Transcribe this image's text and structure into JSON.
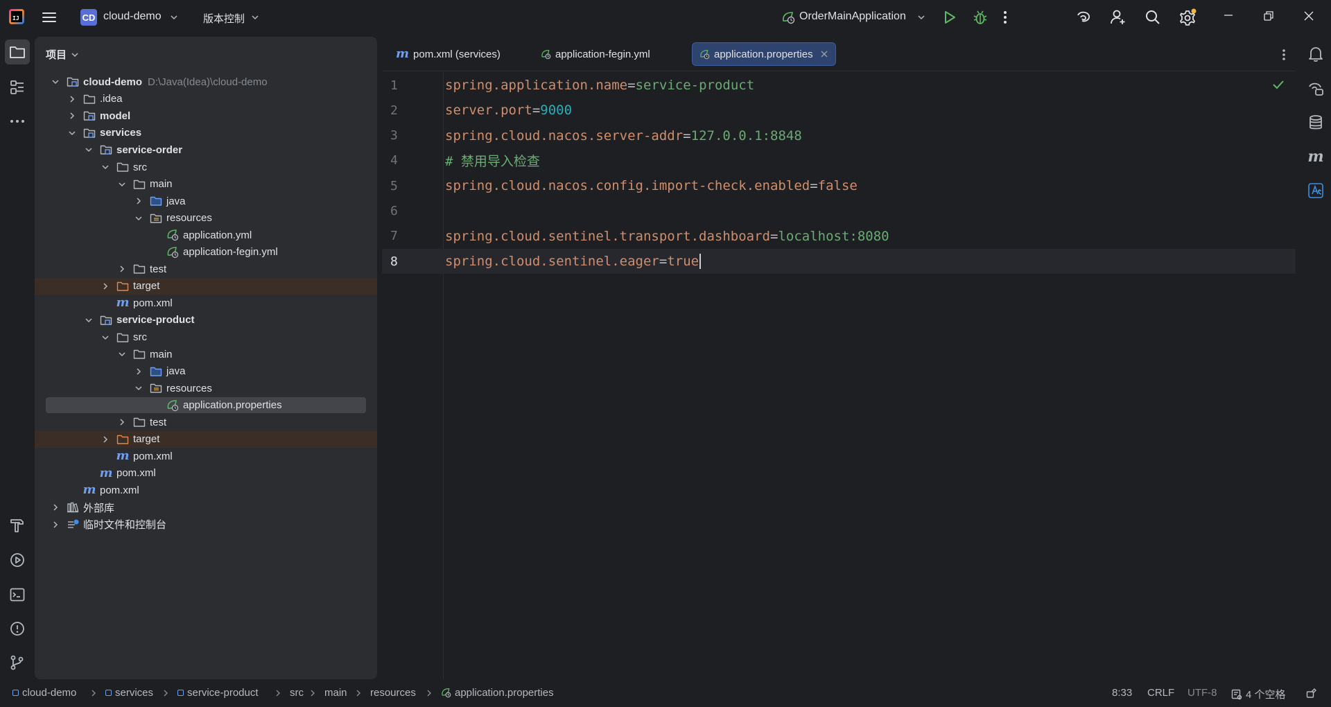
{
  "titlebar": {
    "project_badge": "CD",
    "project_name": "cloud-demo",
    "vcs_menu": "版本控制",
    "run_config": "OrderMainApplication"
  },
  "project_panel": {
    "title": "项目",
    "tree": [
      {
        "label": "cloud-demo",
        "path": "D:\\Java(Idea)\\cloud-demo",
        "bold": true,
        "depth": 0,
        "expander": "open",
        "icon": "module"
      },
      {
        "label": ".idea",
        "depth": 1,
        "expander": "closed",
        "icon": "folder"
      },
      {
        "label": "model",
        "bold": true,
        "depth": 1,
        "expander": "closed",
        "icon": "module"
      },
      {
        "label": "services",
        "bold": true,
        "depth": 1,
        "expander": "open",
        "icon": "module"
      },
      {
        "label": "service-order",
        "bold": true,
        "depth": 2,
        "expander": "open",
        "icon": "module"
      },
      {
        "label": "src",
        "depth": 3,
        "expander": "open",
        "icon": "folder"
      },
      {
        "label": "main",
        "depth": 4,
        "expander": "open",
        "icon": "folder"
      },
      {
        "label": "java",
        "depth": 5,
        "expander": "closed",
        "icon": "folder-src"
      },
      {
        "label": "resources",
        "depth": 5,
        "expander": "open",
        "icon": "folder-res"
      },
      {
        "label": "application.yml",
        "depth": 6,
        "expander": "none",
        "icon": "spring"
      },
      {
        "label": "application-fegin.yml",
        "depth": 6,
        "expander": "none",
        "icon": "spring"
      },
      {
        "label": "test",
        "depth": 4,
        "expander": "closed",
        "icon": "folder"
      },
      {
        "label": "target",
        "depth": 3,
        "expander": "closed",
        "icon": "folder-excluded",
        "excluded": true
      },
      {
        "label": "pom.xml",
        "depth": 3,
        "expander": "none",
        "icon": "maven"
      },
      {
        "label": "service-product",
        "bold": true,
        "depth": 2,
        "expander": "open",
        "icon": "module"
      },
      {
        "label": "src",
        "depth": 3,
        "expander": "open",
        "icon": "folder"
      },
      {
        "label": "main",
        "depth": 4,
        "expander": "open",
        "icon": "folder"
      },
      {
        "label": "java",
        "depth": 5,
        "expander": "closed",
        "icon": "folder-src"
      },
      {
        "label": "resources",
        "depth": 5,
        "expander": "open",
        "icon": "folder-res"
      },
      {
        "label": "application.properties",
        "depth": 6,
        "expander": "none",
        "icon": "spring",
        "selected": true
      },
      {
        "label": "test",
        "depth": 4,
        "expander": "closed",
        "icon": "folder"
      },
      {
        "label": "target",
        "depth": 3,
        "expander": "closed",
        "icon": "folder-excluded",
        "excluded": true
      },
      {
        "label": "pom.xml",
        "depth": 3,
        "expander": "none",
        "icon": "maven"
      },
      {
        "label": "pom.xml",
        "depth": 2,
        "expander": "none",
        "icon": "maven"
      },
      {
        "label": "pom.xml",
        "depth": 1,
        "expander": "none",
        "icon": "maven"
      },
      {
        "label": "外部库",
        "depth": 0,
        "expander": "closed",
        "icon": "library"
      },
      {
        "label": "临时文件和控制台",
        "depth": 0,
        "expander": "closed",
        "icon": "scratch"
      }
    ]
  },
  "editor": {
    "tabs": [
      {
        "label": "pom.xml (services)",
        "icon": "maven",
        "active": false
      },
      {
        "label": "application-fegin.yml",
        "icon": "spring",
        "active": false
      },
      {
        "label": "application.properties",
        "icon": "spring",
        "active": true
      }
    ],
    "lines": [
      {
        "num": "1",
        "parts": [
          {
            "t": "spring.application.name",
            "c": "k"
          },
          {
            "t": "=",
            "c": "eq"
          },
          {
            "t": "service-product",
            "c": "v"
          }
        ]
      },
      {
        "num": "2",
        "parts": [
          {
            "t": "server.port",
            "c": "k"
          },
          {
            "t": "=",
            "c": "eq"
          },
          {
            "t": "9000",
            "c": "n"
          }
        ]
      },
      {
        "num": "3",
        "parts": [
          {
            "t": "spring.cloud.nacos.server-addr",
            "c": "k"
          },
          {
            "t": "=",
            "c": "eq"
          },
          {
            "t": "127.0.0.1:8848",
            "c": "v"
          }
        ]
      },
      {
        "num": "4",
        "parts": [
          {
            "t": "# 禁用导入检查",
            "c": "cm"
          }
        ]
      },
      {
        "num": "5",
        "parts": [
          {
            "t": "spring.cloud.nacos.config.import-check.enabled",
            "c": "k"
          },
          {
            "t": "=",
            "c": "eq"
          },
          {
            "t": "false",
            "c": "k"
          }
        ]
      },
      {
        "num": "6",
        "parts": []
      },
      {
        "num": "7",
        "parts": [
          {
            "t": "spring.cloud.sentinel.transport.dashboard",
            "c": "k"
          },
          {
            "t": "=",
            "c": "eq"
          },
          {
            "t": "localhost:8080",
            "c": "v"
          }
        ]
      },
      {
        "num": "8",
        "current": true,
        "parts": [
          {
            "t": "spring.cloud.sentinel.eager",
            "c": "k"
          },
          {
            "t": "=",
            "c": "eq"
          },
          {
            "t": "true",
            "c": "k"
          }
        ]
      }
    ]
  },
  "statusbar": {
    "breadcrumbs": [
      {
        "label": "cloud-demo",
        "icon": "module"
      },
      {
        "label": "services",
        "icon": "module"
      },
      {
        "label": "service-product",
        "icon": "module"
      },
      {
        "label": "src",
        "icon": "none"
      },
      {
        "label": "main",
        "icon": "none"
      },
      {
        "label": "resources",
        "icon": "none"
      },
      {
        "label": "application.properties",
        "icon": "spring"
      }
    ],
    "position": "8:33",
    "line_separator": "CRLF",
    "encoding": "UTF-8",
    "indent": "4 个空格"
  },
  "colors": {
    "background": "#1e1f22",
    "panel": "#2b2d30",
    "active_tab": "#2e436e",
    "keyword": "#cf8e6d",
    "string": "#6aab73",
    "number": "#2aacb8",
    "spring_green": "#5fb865",
    "maven_blue": "#6f9ff0"
  }
}
